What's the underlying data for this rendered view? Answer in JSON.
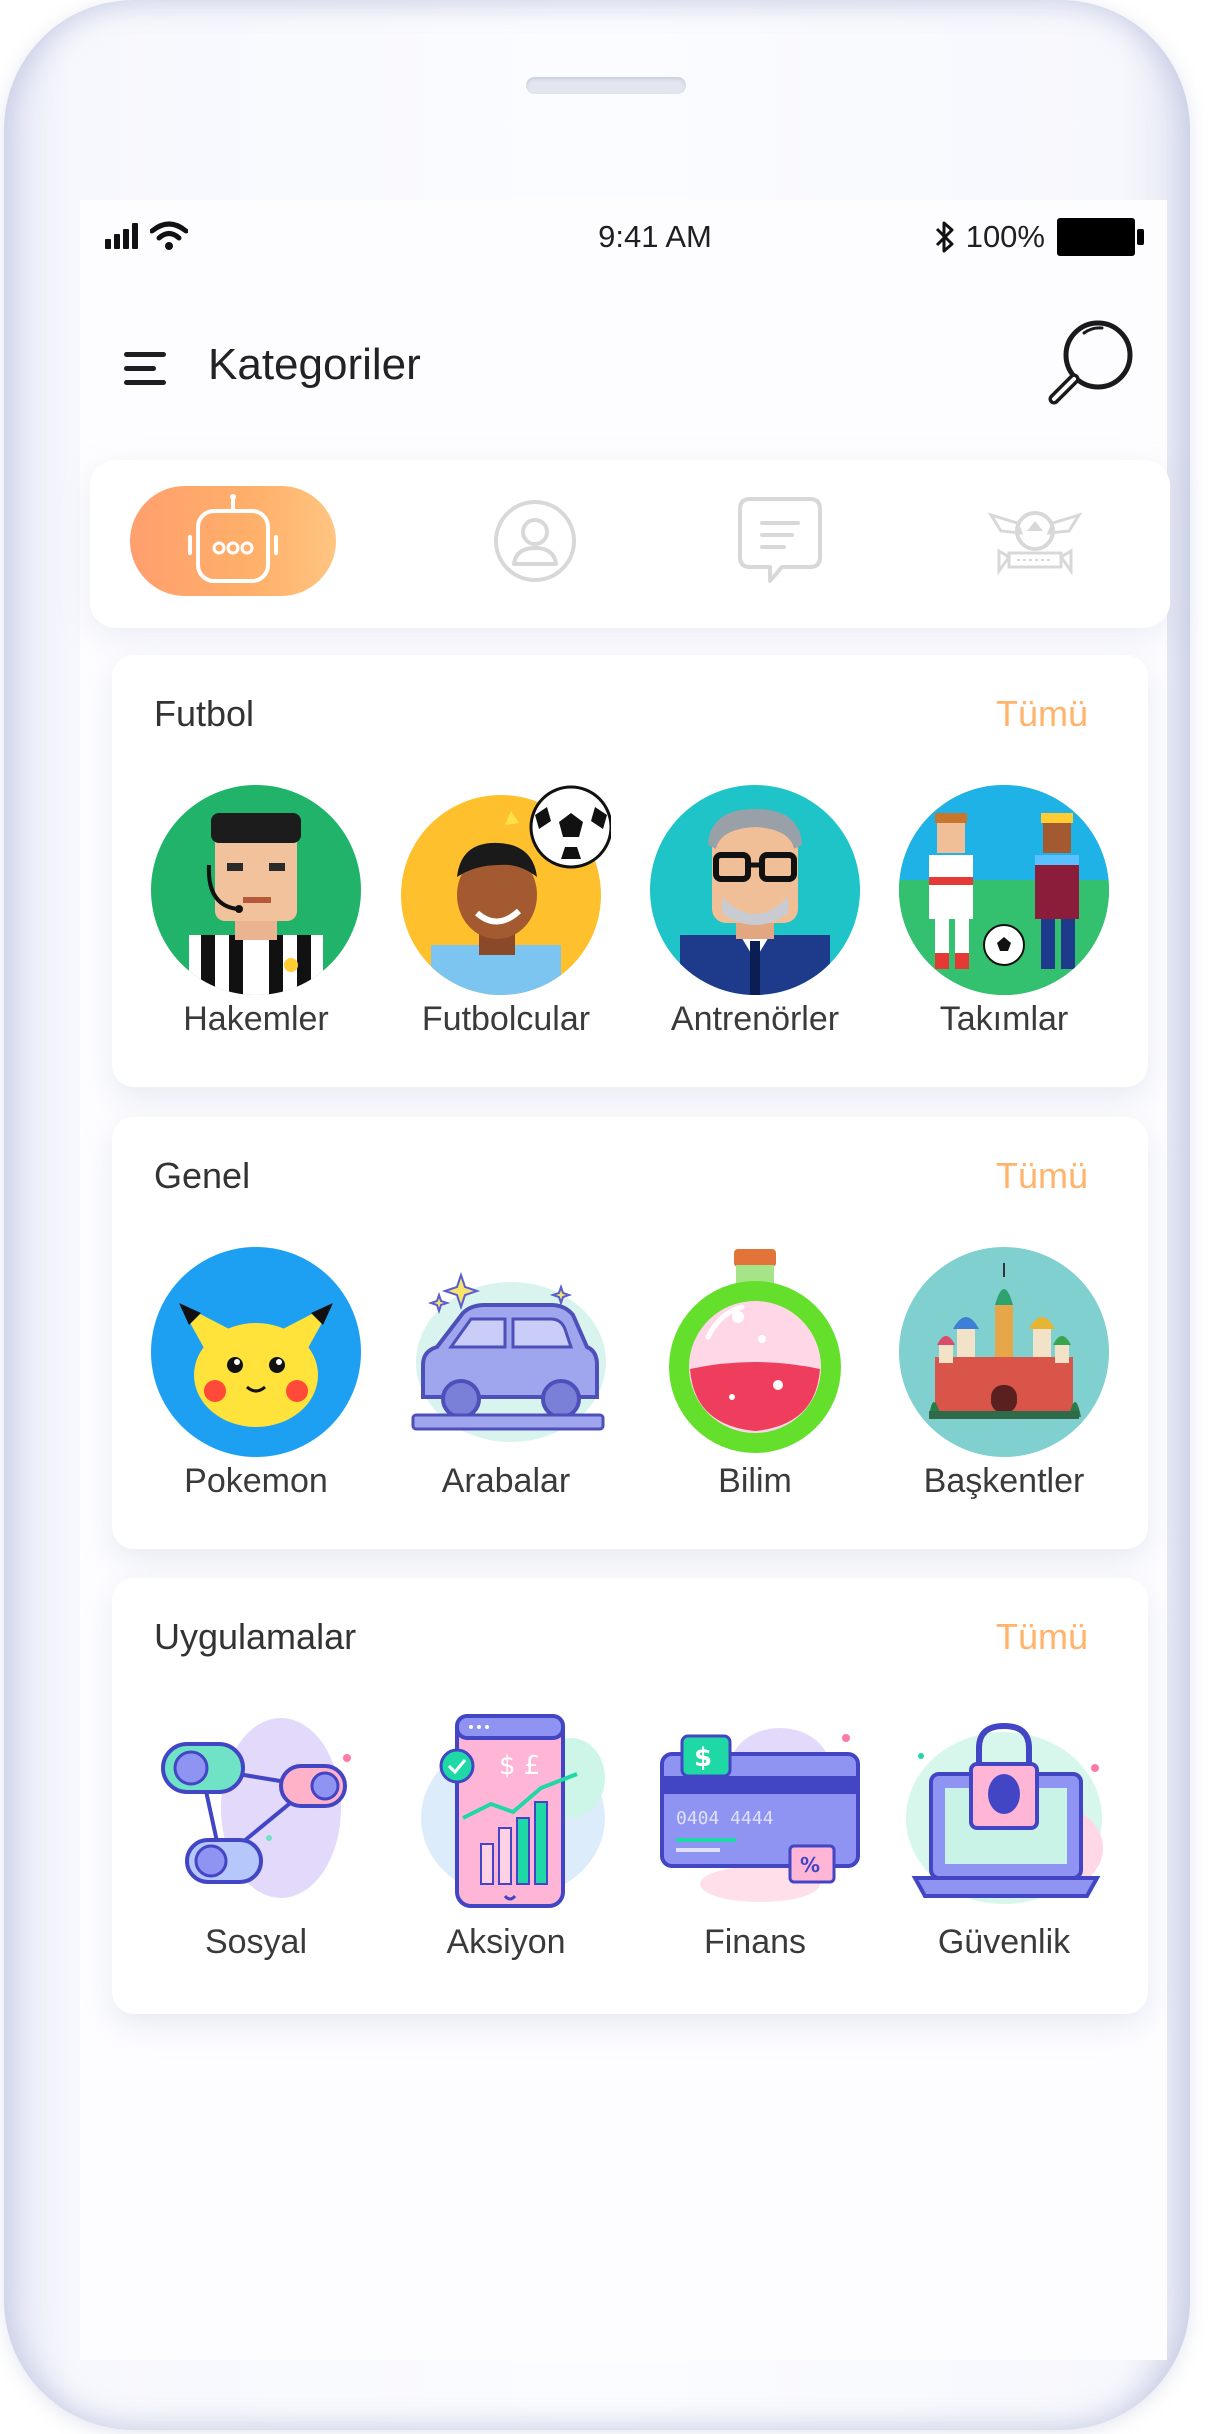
{
  "status_bar": {
    "time": "9:41 AM",
    "battery": "100%"
  },
  "header": {
    "title": "Kategoriler"
  },
  "tabs": [
    {
      "icon": "robot-chat-icon",
      "active": true
    },
    {
      "icon": "user-profile-icon",
      "active": false
    },
    {
      "icon": "message-bubble-icon",
      "active": false
    },
    {
      "icon": "trophy-emblem-icon",
      "active": false
    }
  ],
  "accent_color": "#ffb36b",
  "sections": [
    {
      "title": "Futbol",
      "see_all": "Tümü",
      "items": [
        {
          "label": "Hakemler",
          "icon": "referee-icon"
        },
        {
          "label": "Futbolcular",
          "icon": "football-player-icon"
        },
        {
          "label": "Antrenörler",
          "icon": "coach-icon"
        },
        {
          "label": "Takımlar",
          "icon": "teams-icon"
        }
      ]
    },
    {
      "title": "Genel",
      "see_all": "Tümü",
      "items": [
        {
          "label": "Pokemon",
          "icon": "pikachu-icon"
        },
        {
          "label": "Arabalar",
          "icon": "car-icon"
        },
        {
          "label": "Bilim",
          "icon": "potion-flask-icon"
        },
        {
          "label": "Başkentler",
          "icon": "cathedral-icon"
        }
      ]
    },
    {
      "title": "Uygulamalar",
      "see_all": "Tümü",
      "items": [
        {
          "label": "Sosyal",
          "icon": "social-network-icon"
        },
        {
          "label": "Aksiyon",
          "icon": "stock-phone-icon"
        },
        {
          "label": "Finans",
          "icon": "credit-card-icon"
        },
        {
          "label": "Güvenlik",
          "icon": "security-lock-icon"
        }
      ]
    }
  ]
}
